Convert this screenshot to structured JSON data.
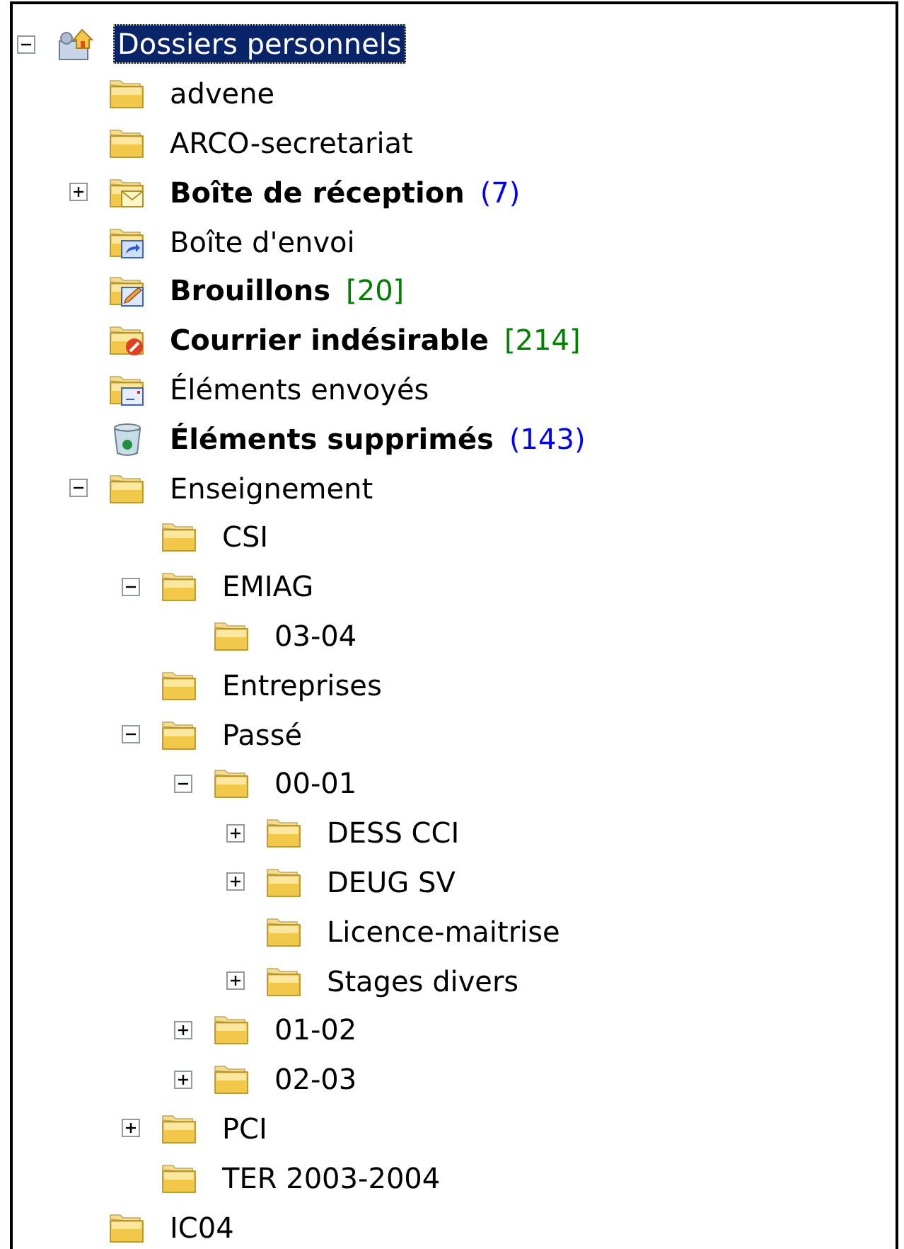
{
  "tree": [
    {
      "label": "Dossiers personnels",
      "kind": "personal",
      "expanded": true,
      "selected": true,
      "bold": false,
      "children": [
        {
          "label": "advene",
          "kind": "folder",
          "selected": false,
          "bold": false
        },
        {
          "label": "ARCO-secretariat",
          "kind": "folder",
          "selected": false,
          "bold": false
        },
        {
          "label": "Boîte de réception",
          "kind": "inbox",
          "expanded": false,
          "selected": false,
          "bold": true,
          "count": {
            "text": "(7)",
            "color": "#0000ff"
          }
        },
        {
          "label": "Boîte d'envoi",
          "kind": "outbox",
          "selected": false,
          "bold": false
        },
        {
          "label": "Brouillons",
          "kind": "drafts",
          "selected": false,
          "bold": true,
          "count": {
            "text": "[20]",
            "color": "#008000"
          }
        },
        {
          "label": "Courrier indésirable",
          "kind": "junk",
          "selected": false,
          "bold": true,
          "count": {
            "text": "[214]",
            "color": "#008000"
          }
        },
        {
          "label": "Éléments envoyés",
          "kind": "sent",
          "selected": false,
          "bold": false
        },
        {
          "label": "Éléments supprimés",
          "kind": "deleted",
          "selected": false,
          "bold": true,
          "count": {
            "text": "(143)",
            "color": "#0000ff"
          }
        },
        {
          "label": "Enseignement",
          "kind": "folder",
          "expanded": true,
          "selected": false,
          "bold": false,
          "children": [
            {
              "label": "CSI",
              "kind": "folder",
              "selected": false,
              "bold": false
            },
            {
              "label": "EMIAG",
              "kind": "folder",
              "expanded": true,
              "selected": false,
              "bold": false,
              "children": [
                {
                  "label": "03-04",
                  "kind": "folder",
                  "selected": false,
                  "bold": false
                }
              ]
            },
            {
              "label": "Entreprises",
              "kind": "folder",
              "selected": false,
              "bold": false
            },
            {
              "label": "Passé",
              "kind": "folder",
              "expanded": true,
              "selected": false,
              "bold": false,
              "children": [
                {
                  "label": "00-01",
                  "kind": "folder",
                  "expanded": true,
                  "selected": false,
                  "bold": false,
                  "children": [
                    {
                      "label": "DESS CCI",
                      "kind": "folder",
                      "expanded": false,
                      "selected": false,
                      "bold": false
                    },
                    {
                      "label": "DEUG SV",
                      "kind": "folder",
                      "expanded": false,
                      "selected": false,
                      "bold": false
                    },
                    {
                      "label": "Licence-maitrise",
                      "kind": "folder",
                      "selected": false,
                      "bold": false
                    },
                    {
                      "label": "Stages divers",
                      "kind": "folder",
                      "expanded": false,
                      "selected": false,
                      "bold": false
                    }
                  ]
                },
                {
                  "label": "01-02",
                  "kind": "folder",
                  "expanded": false,
                  "selected": false,
                  "bold": false
                },
                {
                  "label": "02-03",
                  "kind": "folder",
                  "expanded": false,
                  "selected": false,
                  "bold": false
                }
              ]
            },
            {
              "label": "PCI",
              "kind": "folder",
              "expanded": false,
              "selected": false,
              "bold": false
            },
            {
              "label": "TER 2003-2004",
              "kind": "folder",
              "selected": false,
              "bold": false
            }
          ]
        },
        {
          "label": "IC04",
          "kind": "folder",
          "selected": false,
          "bold": false
        }
      ]
    }
  ]
}
